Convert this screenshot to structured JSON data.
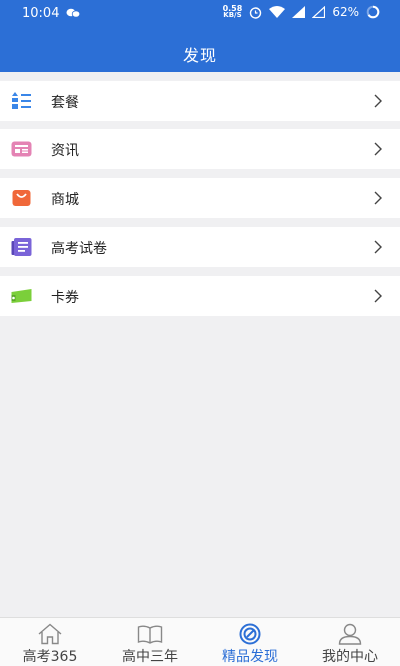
{
  "status_bar": {
    "time": "10:04",
    "speed_value": "0.58",
    "speed_unit": "KB/S",
    "battery": "62%"
  },
  "header": {
    "title": "发现"
  },
  "menu": {
    "items": [
      {
        "label": "套餐",
        "icon": "package-list-icon",
        "color": "#3a86e8"
      },
      {
        "label": "资讯",
        "icon": "news-card-icon",
        "color": "#e483b4"
      },
      {
        "label": "商城",
        "icon": "shop-bag-icon",
        "color": "#f0683a"
      },
      {
        "label": "高考试卷",
        "icon": "exam-paper-icon",
        "color": "#7a64d8"
      },
      {
        "label": "卡券",
        "icon": "coupon-ticket-icon",
        "color": "#7bcf3a"
      }
    ]
  },
  "bottom_nav": {
    "items": [
      {
        "label": "高考365",
        "icon": "home-icon",
        "active": false
      },
      {
        "label": "高中三年",
        "icon": "book-icon",
        "active": false
      },
      {
        "label": "精品发现",
        "icon": "discover-compass-icon",
        "active": true
      },
      {
        "label": "我的中心",
        "icon": "user-profile-icon",
        "active": false
      }
    ]
  },
  "colors": {
    "primary": "#2c6fd6",
    "background": "#f0f0f2"
  }
}
